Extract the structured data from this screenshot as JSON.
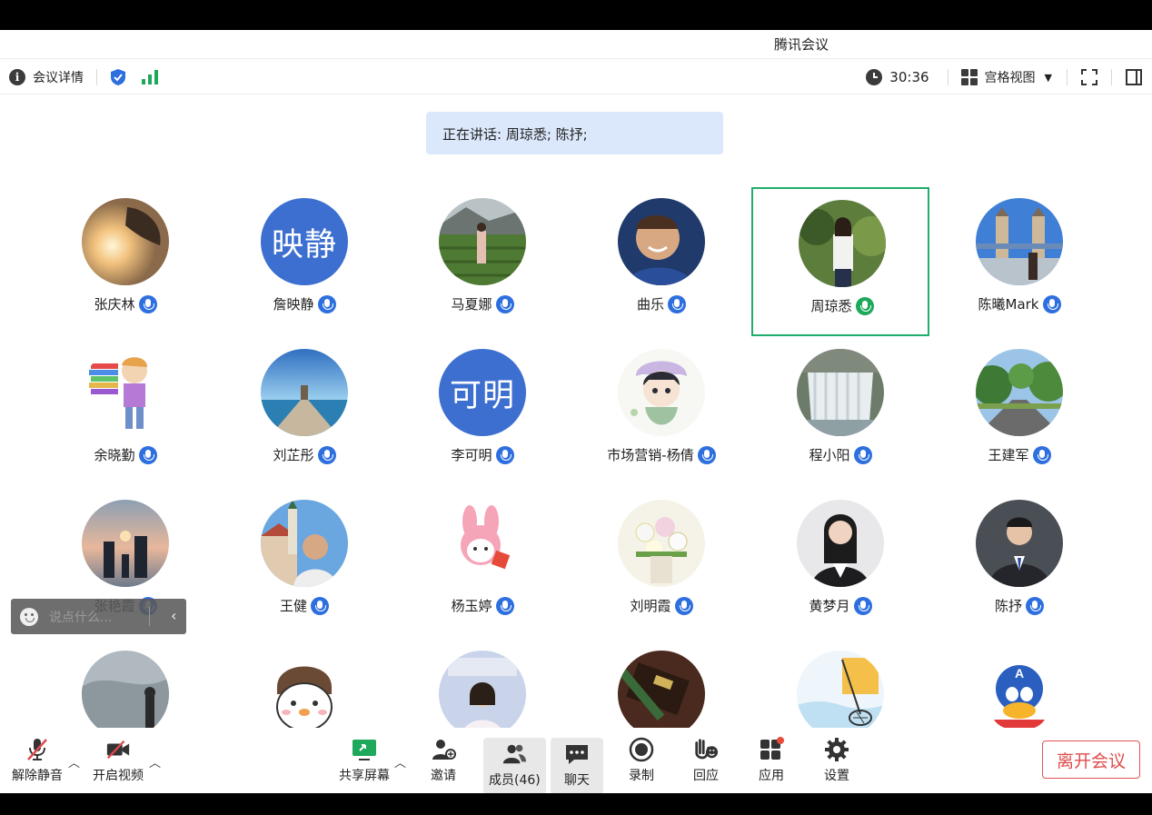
{
  "window": {
    "title": "腾讯会议"
  },
  "topbar": {
    "meeting_details_label": "会议详情",
    "timer": "30:36",
    "view_mode_label": "宫格视图"
  },
  "speaking": {
    "text": "正在讲话: 周琼悉; 陈抒;"
  },
  "participants": [
    {
      "name": "张庆林",
      "avatar": "photo-sunset-silhouette",
      "avatar_text": "",
      "speaking": false
    },
    {
      "name": "詹映静",
      "avatar": "text",
      "avatar_text": "映静",
      "speaking": false
    },
    {
      "name": "马夏娜",
      "avatar": "photo-tea-field",
      "avatar_text": "",
      "speaking": false
    },
    {
      "name": "曲乐",
      "avatar": "photo-smiling-man",
      "avatar_text": "",
      "speaking": false
    },
    {
      "name": "周琼悉",
      "avatar": "photo-woman-garden",
      "avatar_text": "",
      "speaking": true
    },
    {
      "name": "陈曦Mark",
      "avatar": "photo-tower-bridge",
      "avatar_text": "",
      "speaking": false
    },
    {
      "name": "余晓勤",
      "avatar": "cartoon-books",
      "avatar_text": "",
      "speaking": false
    },
    {
      "name": "刘芷彤",
      "avatar": "photo-pier-sea",
      "avatar_text": "",
      "speaking": false
    },
    {
      "name": "李可明",
      "avatar": "text",
      "avatar_text": "可明",
      "speaking": false
    },
    {
      "name": "市场营销-杨倩",
      "avatar": "anime-girl",
      "avatar_text": "",
      "speaking": false
    },
    {
      "name": "程小阳",
      "avatar": "photo-waterfall",
      "avatar_text": "",
      "speaking": false
    },
    {
      "name": "王建军",
      "avatar": "photo-tree-road",
      "avatar_text": "",
      "speaking": false
    },
    {
      "name": "张艳霞",
      "avatar": "photo-family-beach",
      "avatar_text": "",
      "speaking": false
    },
    {
      "name": "王健",
      "avatar": "photo-man-town",
      "avatar_text": "",
      "speaking": false
    },
    {
      "name": "杨玉婷",
      "avatar": "cartoon-melody",
      "avatar_text": "",
      "speaking": false
    },
    {
      "name": "刘明霞",
      "avatar": "photo-flowers",
      "avatar_text": "",
      "speaking": false
    },
    {
      "name": "黄梦月",
      "avatar": "photo-woman-suit",
      "avatar_text": "",
      "speaking": false
    },
    {
      "name": "陈抒",
      "avatar": "photo-man-suit",
      "avatar_text": "",
      "speaking": false
    },
    {
      "name": "",
      "avatar": "photo-misty-landscape",
      "avatar_text": "",
      "speaking": false
    },
    {
      "name": "",
      "avatar": "cartoon-bird-girl",
      "avatar_text": "",
      "speaking": false
    },
    {
      "name": "",
      "avatar": "photo-child-poster",
      "avatar_text": "",
      "speaking": false
    },
    {
      "name": "",
      "avatar": "photo-pen-notebook",
      "avatar_text": "",
      "speaking": false
    },
    {
      "name": "",
      "avatar": "cartoon-fishing-net",
      "avatar_text": "",
      "speaking": false
    },
    {
      "name": "",
      "avatar": "cartoon-captain-duck",
      "avatar_text": "",
      "speaking": false
    }
  ],
  "chat": {
    "placeholder": "说点什么..."
  },
  "toolbar": {
    "unmute_label": "解除静音",
    "start_video_label": "开启视频",
    "share_screen_label": "共享屏幕",
    "invite_label": "邀请",
    "members_label": "成员(46)",
    "chat_label": "聊天",
    "record_label": "录制",
    "reactions_label": "回应",
    "apps_label": "应用",
    "settings_label": "设置",
    "leave_label": "离开会议"
  },
  "colors": {
    "accent_blue": "#2e6fdf",
    "speaking_green": "#1fae6a",
    "leave_red": "#e04b4b",
    "speaking_bar": "#dbe8fb",
    "signal_green": "#1da85b"
  }
}
